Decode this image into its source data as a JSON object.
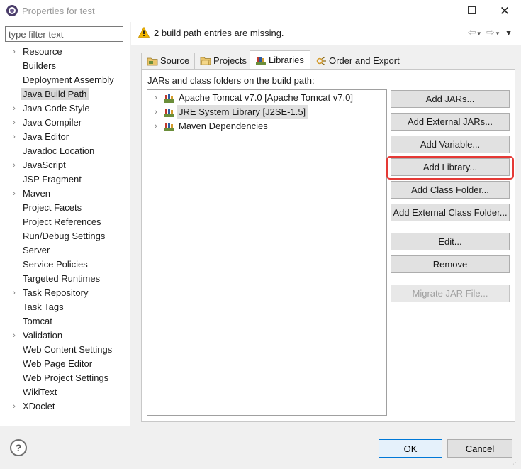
{
  "window": {
    "title": "Properties for test",
    "maximize_icon": "maximize-icon",
    "close_glyph": "✕"
  },
  "filter": {
    "placeholder": "type filter text",
    "value": ""
  },
  "nav_items": [
    {
      "label": "Resource",
      "expandable": true
    },
    {
      "label": "Builders",
      "expandable": false
    },
    {
      "label": "Deployment Assembly",
      "expandable": false
    },
    {
      "label": "Java Build Path",
      "expandable": false,
      "selected": true
    },
    {
      "label": "Java Code Style",
      "expandable": true
    },
    {
      "label": "Java Compiler",
      "expandable": true
    },
    {
      "label": "Java Editor",
      "expandable": true
    },
    {
      "label": "Javadoc Location",
      "expandable": false
    },
    {
      "label": "JavaScript",
      "expandable": true
    },
    {
      "label": "JSP Fragment",
      "expandable": false
    },
    {
      "label": "Maven",
      "expandable": true
    },
    {
      "label": "Project Facets",
      "expandable": false
    },
    {
      "label": "Project References",
      "expandable": false
    },
    {
      "label": "Run/Debug Settings",
      "expandable": false
    },
    {
      "label": "Server",
      "expandable": false
    },
    {
      "label": "Service Policies",
      "expandable": false
    },
    {
      "label": "Targeted Runtimes",
      "expandable": false
    },
    {
      "label": "Task Repository",
      "expandable": true
    },
    {
      "label": "Task Tags",
      "expandable": false
    },
    {
      "label": "Tomcat",
      "expandable": false
    },
    {
      "label": "Validation",
      "expandable": true
    },
    {
      "label": "Web Content Settings",
      "expandable": false
    },
    {
      "label": "Web Page Editor",
      "expandable": false
    },
    {
      "label": "Web Project Settings",
      "expandable": false
    },
    {
      "label": "WikiText",
      "expandable": false
    },
    {
      "label": "XDoclet",
      "expandable": true
    }
  ],
  "message": {
    "text": "2 build path entries are missing.",
    "icon": "warning-icon",
    "back_glyph": "⇦",
    "forward_glyph": "⇨",
    "dropdown_glyph": "▾",
    "menu_glyph": "▼"
  },
  "tabs": [
    {
      "label": "Source",
      "icon": "source-folder-icon"
    },
    {
      "label": "Projects",
      "icon": "projects-icon"
    },
    {
      "label": "Libraries",
      "icon": "libraries-icon",
      "active": true
    },
    {
      "label": "Order and Export",
      "icon": "order-export-icon"
    }
  ],
  "libraries": {
    "label": "JARs and class folders on the build path:",
    "entries": [
      {
        "label": "Apache Tomcat v7.0 [Apache Tomcat v7.0]"
      },
      {
        "label": "JRE System Library [J2SE-1.5]",
        "selected": true
      },
      {
        "label": "Maven Dependencies"
      }
    ],
    "buttons": [
      {
        "label": "Add JARs...",
        "enabled": true
      },
      {
        "label": "Add External JARs...",
        "enabled": true
      },
      {
        "label": "Add Variable...",
        "enabled": true
      },
      {
        "label": "Add Library...",
        "enabled": true,
        "highlighted": true
      },
      {
        "label": "Add Class Folder...",
        "enabled": true
      },
      {
        "label": "Add External Class Folder...",
        "enabled": true
      },
      {
        "label": "Edit...",
        "enabled": true
      },
      {
        "label": "Remove",
        "enabled": true
      },
      {
        "label": "Migrate JAR File...",
        "enabled": false
      }
    ]
  },
  "footer": {
    "help_glyph": "?",
    "ok_label": "OK",
    "cancel_label": "Cancel"
  },
  "colors": {
    "highlight": "#e53935",
    "ok_border": "#0078d7",
    "warning": "#f2b600"
  }
}
